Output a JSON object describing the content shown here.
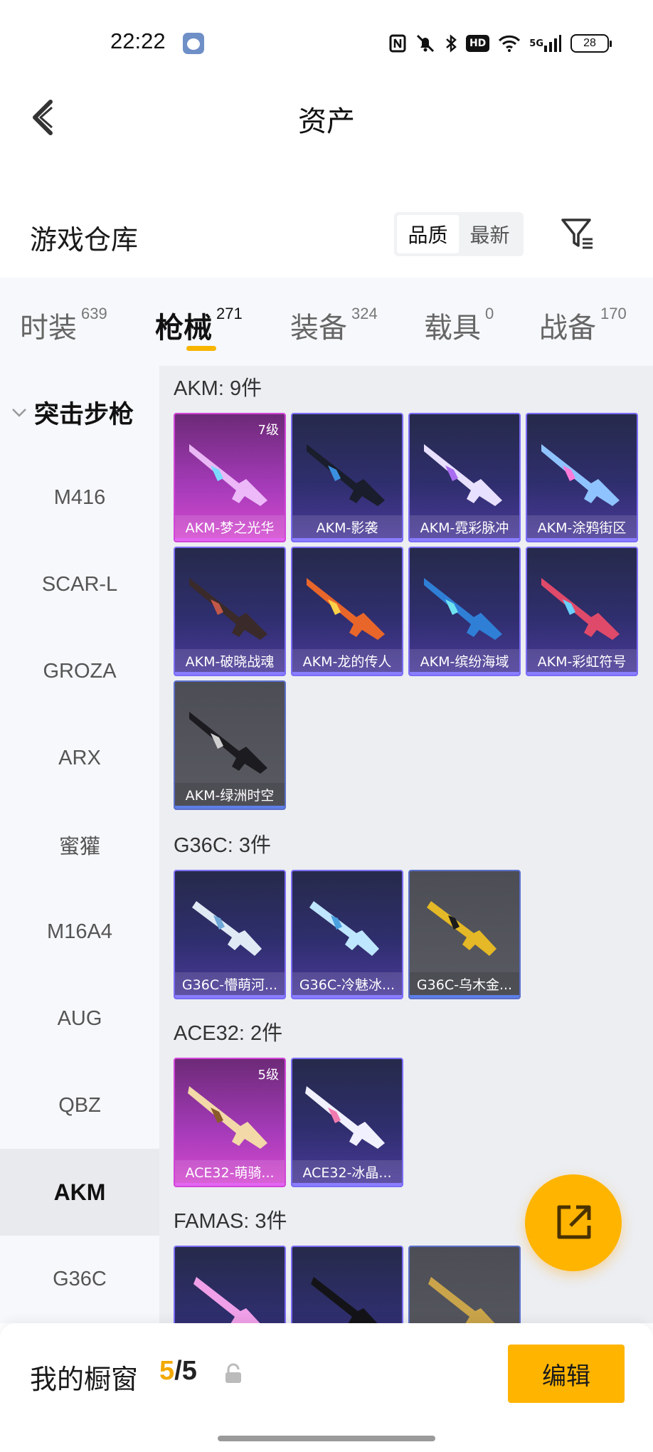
{
  "status_bar": {
    "time": "22:22",
    "icons": [
      "nfc-icon",
      "mute-icon",
      "bluetooth-icon",
      "hd-icon",
      "wifi-icon",
      "5g-signal-icon"
    ],
    "hd_label": "HD",
    "network_label": "5G",
    "battery": "28"
  },
  "header": {
    "title": "资产"
  },
  "warehouse": {
    "title": "游戏仓库",
    "sort_options": [
      "品质",
      "最新"
    ],
    "sort_selected": "品质"
  },
  "tabs": [
    {
      "label": "时装",
      "count": "639"
    },
    {
      "label": "枪械",
      "count": "271",
      "active": true
    },
    {
      "label": "装备",
      "count": "324"
    },
    {
      "label": "载具",
      "count": "0"
    },
    {
      "label": "战备",
      "count": "170"
    }
  ],
  "sidebar": {
    "group": "突击步枪",
    "items": [
      "M416",
      "SCAR-L",
      "GROZA",
      "ARX",
      "蜜獾",
      "M16A4",
      "AUG",
      "QBZ",
      "AKM",
      "G36C"
    ],
    "active": "AKM"
  },
  "sections": [
    {
      "title": "AKM: 9件",
      "cards": [
        {
          "name": "AKM-梦之光华",
          "level": "7级",
          "rarity": "pink"
        },
        {
          "name": "AKM-影袭",
          "level": "",
          "rarity": "purple"
        },
        {
          "name": "AKM-霓彩脉冲",
          "level": "",
          "rarity": "purple"
        },
        {
          "name": "AKM-涂鸦街区",
          "level": "",
          "rarity": "purple"
        },
        {
          "name": "AKM-破晓战魂",
          "level": "",
          "rarity": "purple"
        },
        {
          "name": "AKM-龙的传人",
          "level": "",
          "rarity": "purple"
        },
        {
          "name": "AKM-缤纷海域",
          "level": "",
          "rarity": "purple"
        },
        {
          "name": "AKM-彩虹符号",
          "level": "",
          "rarity": "purple"
        },
        {
          "name": "AKM-绿洲时空",
          "level": "",
          "rarity": "grey"
        }
      ]
    },
    {
      "title": "G36C: 3件",
      "cards": [
        {
          "name": "G36C-懵萌河...",
          "level": "",
          "rarity": "purple"
        },
        {
          "name": "G36C-冷魅冰...",
          "level": "",
          "rarity": "purple"
        },
        {
          "name": "G36C-乌木金...",
          "level": "",
          "rarity": "grey"
        }
      ]
    },
    {
      "title": "ACE32: 2件",
      "cards": [
        {
          "name": "ACE32-萌骑...",
          "level": "5级",
          "rarity": "pink"
        },
        {
          "name": "ACE32-冰晶...",
          "level": "",
          "rarity": "purple"
        }
      ]
    },
    {
      "title": "FAMAS: 3件",
      "cards": [
        {
          "name": "",
          "level": "",
          "rarity": "purple"
        },
        {
          "name": "",
          "level": "",
          "rarity": "purple"
        },
        {
          "name": "",
          "level": "",
          "rarity": "grey"
        }
      ]
    }
  ],
  "bottom_bar": {
    "showcase_label": "我的橱窗",
    "showcase_current": "5",
    "showcase_sep": "/",
    "showcase_max": "5",
    "edit_label": "编辑"
  },
  "colors": {
    "accent": "#ffb400",
    "rarity_pink": "#d245d8",
    "rarity_purple": "#7b6cf5",
    "rarity_grey": "#5b6fc9"
  }
}
